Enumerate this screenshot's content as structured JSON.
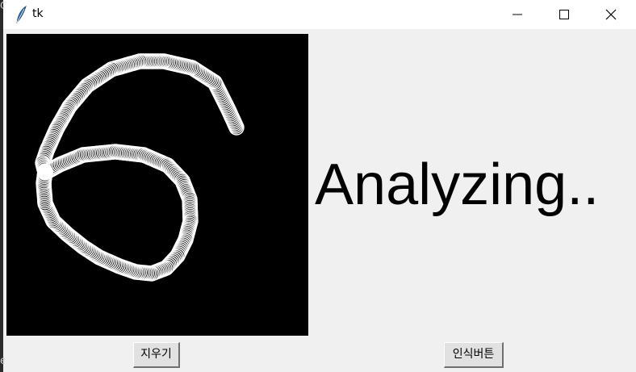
{
  "window": {
    "title": "tk",
    "icon": "feather-icon",
    "controls": [
      "minimize-icon",
      "maximize-icon",
      "close-icon"
    ]
  },
  "canvas": {
    "background": "#000000",
    "stroke_color": "#ffffff",
    "content": "handwritten digit drawing"
  },
  "status": {
    "text": "Analyzing.."
  },
  "buttons": {
    "erase_label": "지우기",
    "recognize_label": "인식버튼"
  },
  "colors": {
    "window_bg": "#f0f0f0",
    "titlebar_bg": "#ffffff",
    "button_bg": "#e1e1e1"
  }
}
